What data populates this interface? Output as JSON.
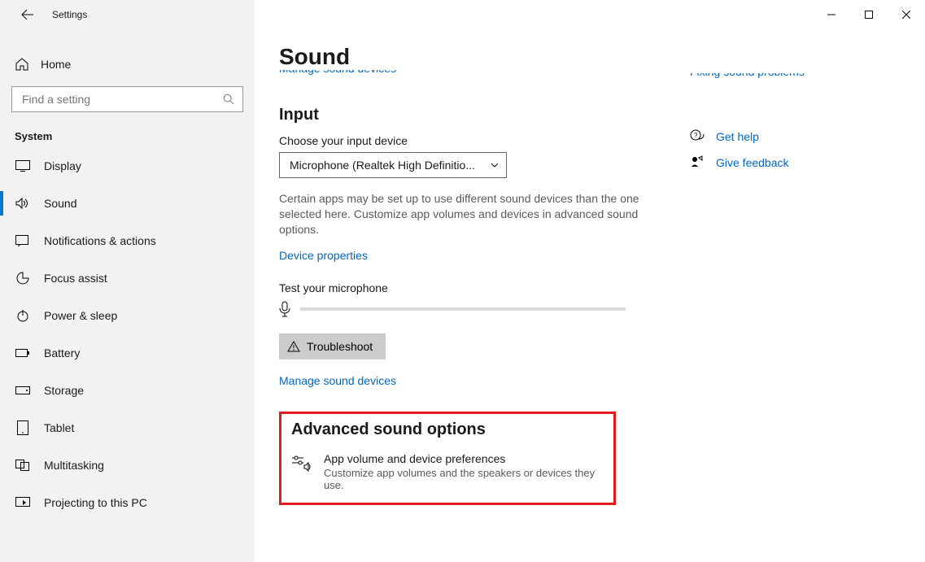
{
  "window": {
    "title": "Settings"
  },
  "sidebar": {
    "home": "Home",
    "search_placeholder": "Find a setting",
    "group": "System",
    "items": [
      {
        "label": "Display"
      },
      {
        "label": "Sound"
      },
      {
        "label": "Notifications & actions"
      },
      {
        "label": "Focus assist"
      },
      {
        "label": "Power & sleep"
      },
      {
        "label": "Battery"
      },
      {
        "label": "Storage"
      },
      {
        "label": "Tablet"
      },
      {
        "label": "Multitasking"
      },
      {
        "label": "Projecting to this PC"
      }
    ]
  },
  "main": {
    "title": "Sound",
    "manage_top": "Manage sound devices",
    "input_section": "Input",
    "choose_label": "Choose your input device",
    "input_device": "Microphone (Realtek High Definitio...",
    "input_desc": "Certain apps may be set up to use different sound devices than the one selected here. Customize app volumes and devices in advanced sound options.",
    "device_props": "Device properties",
    "test_label": "Test your microphone",
    "troubleshoot": "Troubleshoot",
    "manage_lower": "Manage sound devices",
    "advanced_title": "Advanced sound options",
    "adv_item_title": "App volume and device preferences",
    "adv_item_desc": "Customize app volumes and the speakers or devices they use."
  },
  "right": {
    "fixing": "Fixing sound problems",
    "get_help": "Get help",
    "give_feedback": "Give feedback"
  }
}
